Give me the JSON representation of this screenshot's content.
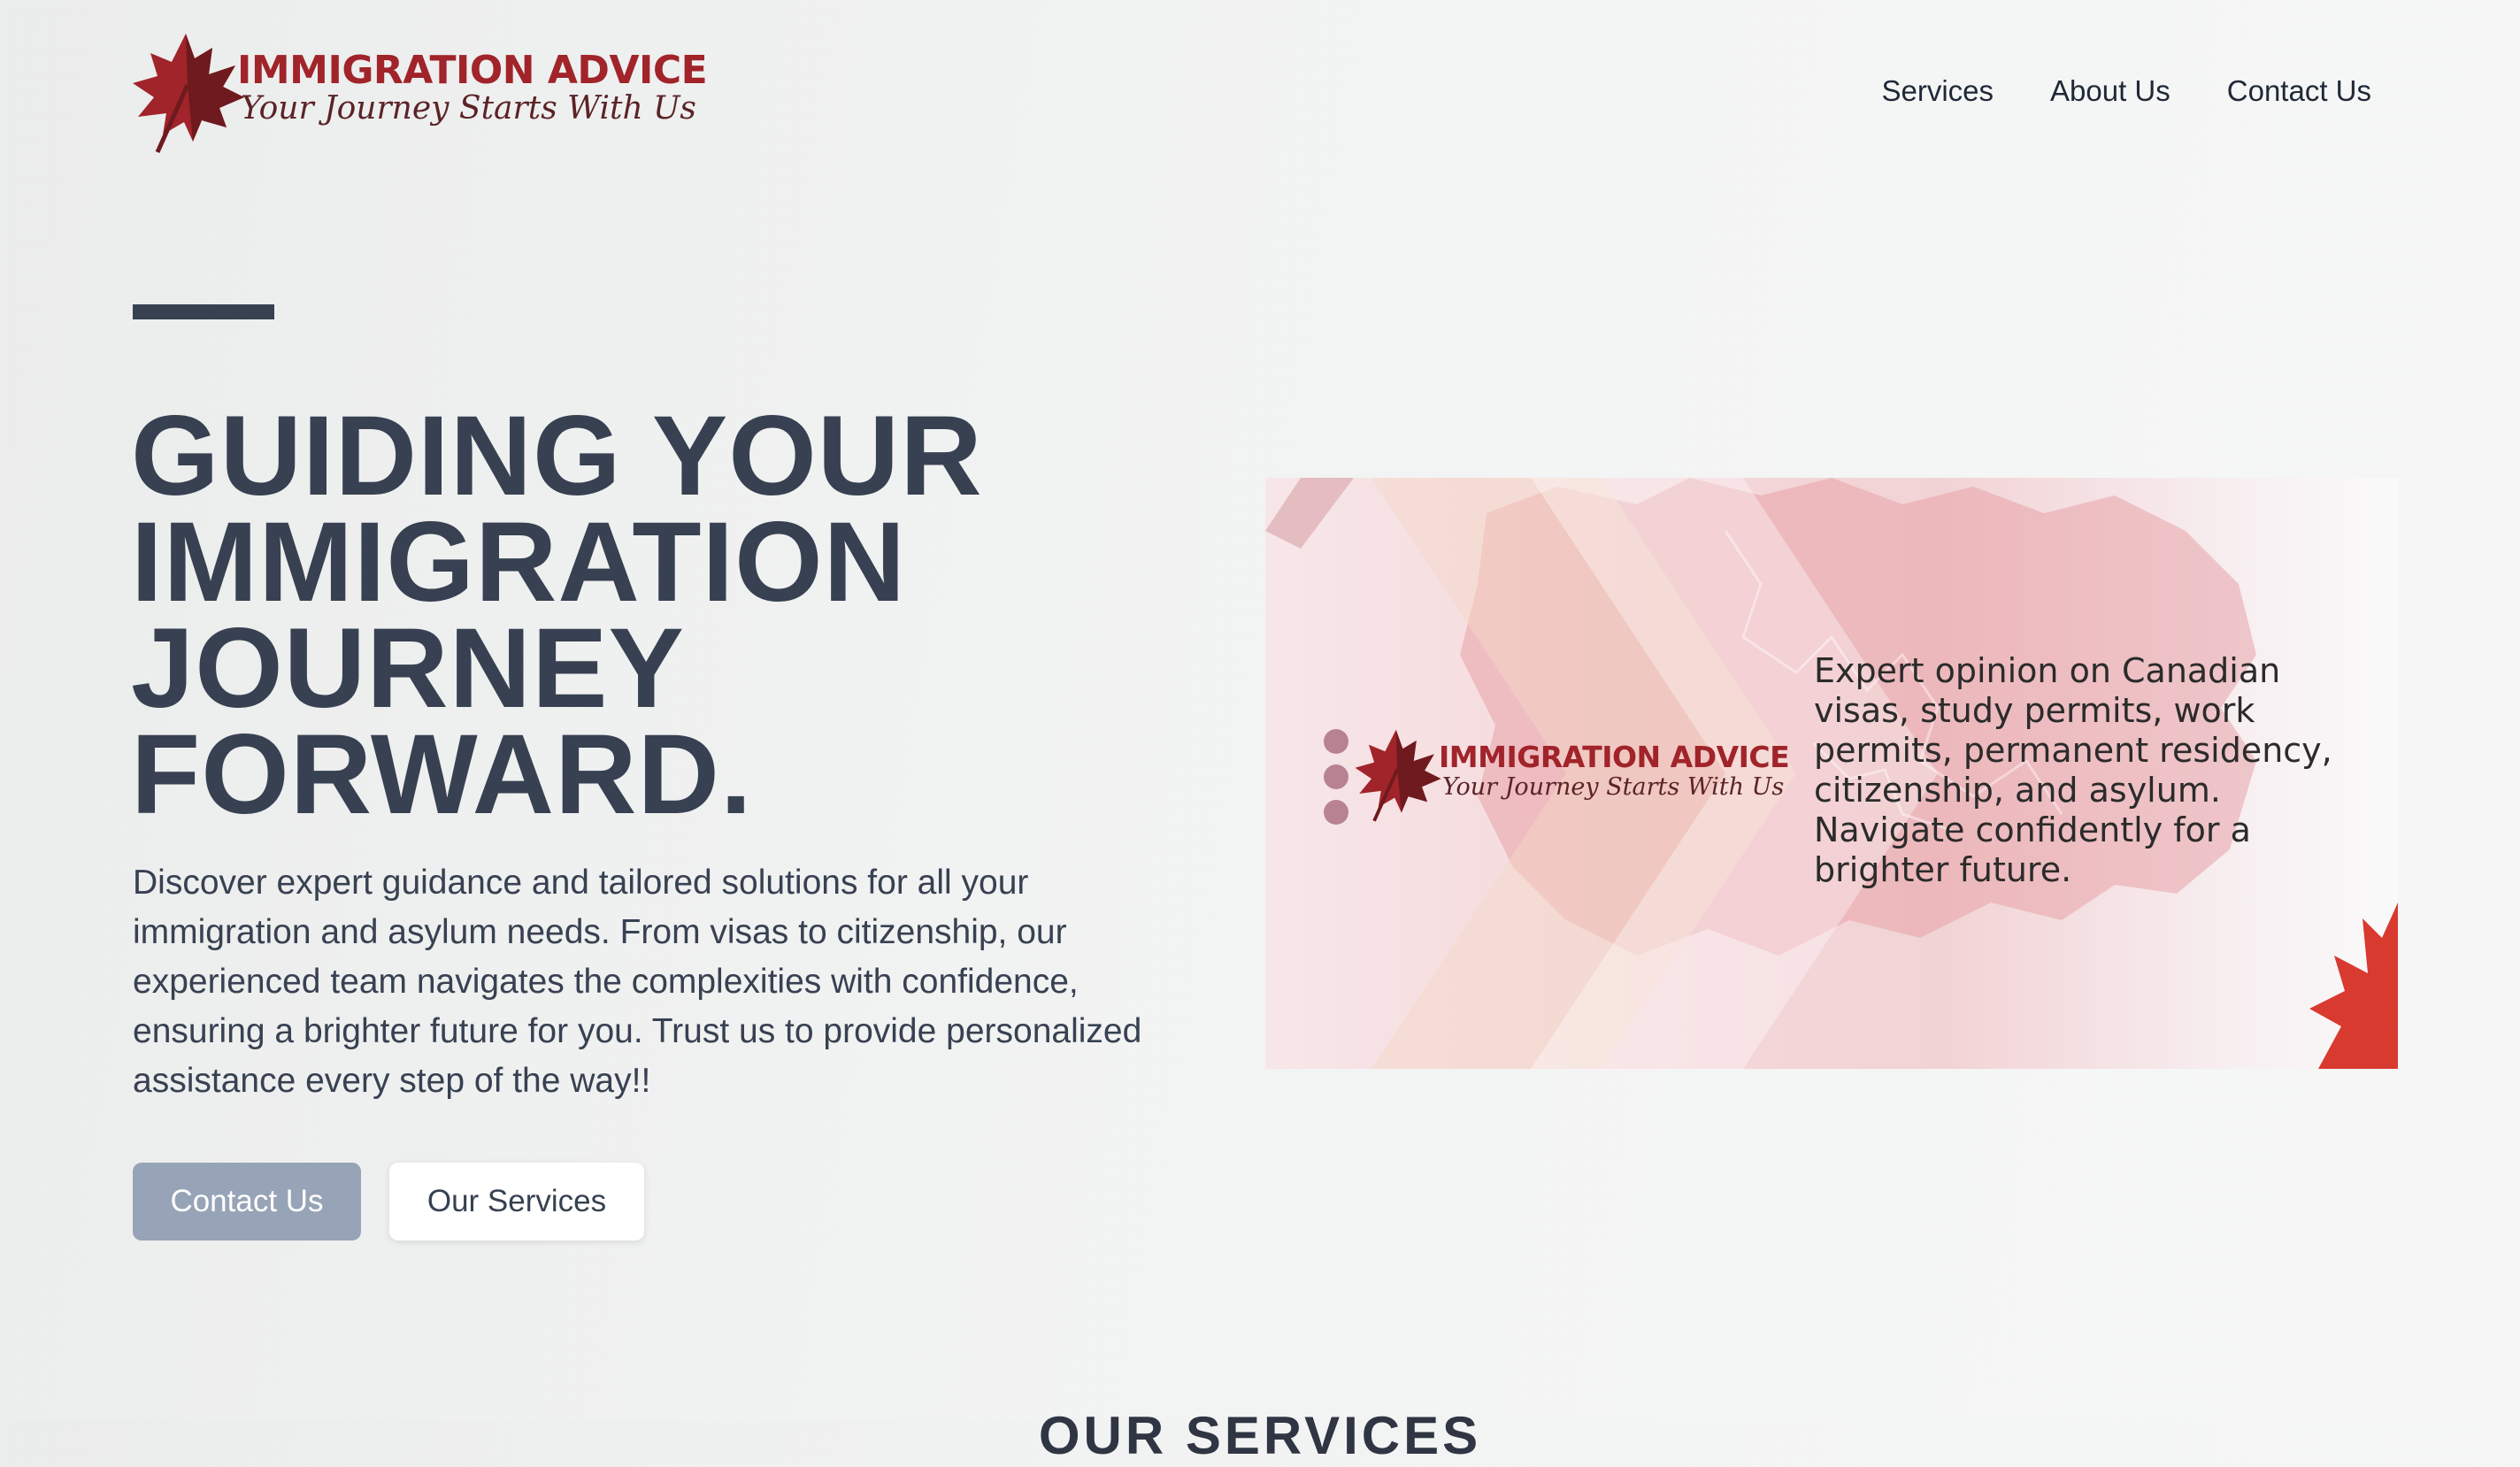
{
  "brand": {
    "name": "IMMIGRATION ADVICE",
    "tagline": "Your Journey Starts With Us",
    "primary_color": "#a0242a",
    "leaf_icon": "maple-leaf-icon"
  },
  "nav": {
    "items": [
      {
        "label": "Services"
      },
      {
        "label": "About Us"
      },
      {
        "label": "Contact Us"
      }
    ]
  },
  "hero": {
    "title_lines": [
      "GUIDING YOUR",
      "IMMIGRATION",
      "JOURNEY",
      "FORWARD."
    ],
    "description": "Discover expert guidance and tailored solutions for all your immigration and asylum needs. From visas to citizenship, our experienced team navigates the complexities with confidence, ensuring a brighter future for you. Trust us to provide personalized assistance every step of the way!!",
    "primary_button": "Contact Us",
    "secondary_button": "Our Services",
    "text_color": "#374151",
    "primary_button_color": "#97a3b6"
  },
  "banner": {
    "brand_name": "IMMIGRATION ADVICE",
    "brand_tagline": "Your Journey Starts With Us",
    "text": "Expert opinion on Canadian visas, study permits, work permits, permanent residency, citizenship, and asylum. Navigate confidently for a brighter future.",
    "accent_color": "#d83a2f"
  },
  "section": {
    "heading": "OUR SERVICES"
  }
}
